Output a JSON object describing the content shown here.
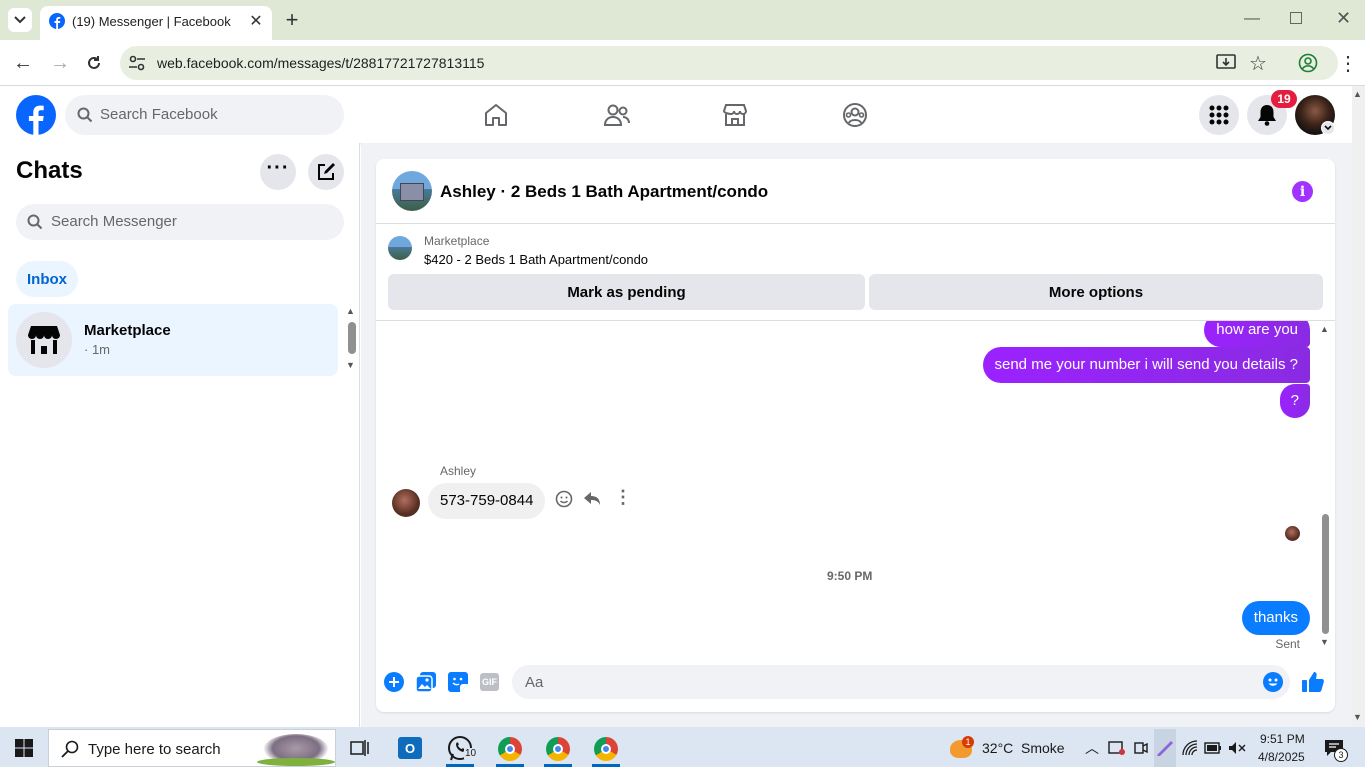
{
  "browser": {
    "tab_title": "(19) Messenger | Facebook",
    "url": "web.facebook.com/messages/t/28817721727813115"
  },
  "fb": {
    "search_placeholder": "Search Facebook",
    "notifications_count": "19"
  },
  "chats": {
    "title": "Chats",
    "search_placeholder": "Search Messenger",
    "filter_inbox": "Inbox",
    "items": [
      {
        "name": "Marketplace",
        "meta": "· 1m"
      }
    ]
  },
  "conversation": {
    "title": "Ashley · 2 Beds 1 Bath Apartment/condo",
    "listing_label": "Marketplace",
    "listing_title": "$420 - 2 Beds 1 Bath Apartment/condo",
    "mark_pending": "Mark as pending",
    "more_options": "More options",
    "messages": {
      "m1": "how are you",
      "m2": "send me your number i will send you details ?",
      "m3": "?",
      "sender": "Ashley",
      "m4": "573-759-0844",
      "time": "9:50 PM",
      "m5": "thanks",
      "status": "Sent"
    },
    "composer_placeholder": "Aa"
  },
  "taskbar": {
    "search_placeholder": "Type here to search",
    "whatsapp_badge": "10",
    "weather_temp": "32°C",
    "weather_desc": "Smoke",
    "weather_badge": "1",
    "time": "9:51 PM",
    "date": "4/8/2025",
    "notif_count": "3"
  },
  "colors": {
    "fb_blue": "#0866ff",
    "purple": "#a033ff",
    "bubble_blue": "#0a7cff"
  }
}
